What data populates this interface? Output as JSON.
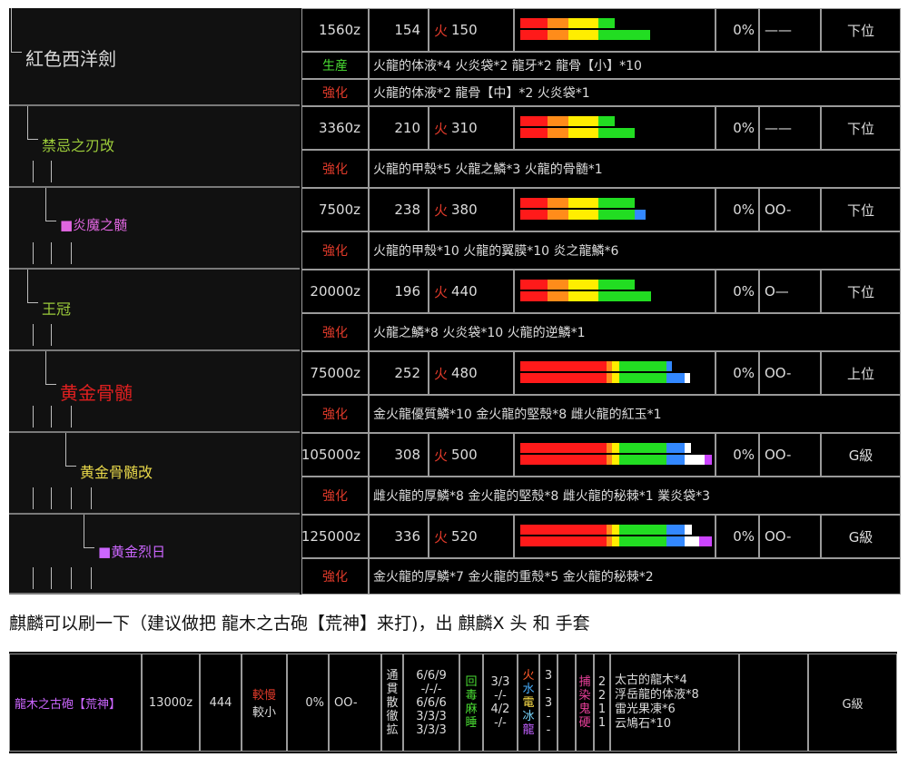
{
  "colors": {
    "fire": "#e03a2a",
    "gen": "#4ade33",
    "str": "#e03a2a",
    "white_name": "#d8d8d8",
    "green_name": "#9ccc3a",
    "pink_name": "#e066e0",
    "red_name": "#e02020",
    "yellow_name": "#e8d84a",
    "purple_name": "#cc66ff",
    "bar_red": "#ff1a1a",
    "bar_orange": "#ff8c1a",
    "bar_yellow": "#ffee00",
    "bar_green": "#22dd22",
    "bar_blue": "#3388ff",
    "bar_white": "#ffffff",
    "bar_purple": "#cc44ff"
  },
  "weapons": [
    {
      "name": "紅色西洋劍",
      "price": "1560z",
      "attack": "154",
      "element": "火",
      "element_value": "150",
      "affinity": "0%",
      "slots": "——",
      "rank": "下位",
      "recipes": [
        {
          "label": "生産",
          "text": "火龍的体液*4 火炎袋*2 龍牙*2 龍骨【小】*10"
        },
        {
          "label": "強化",
          "text": "火龍的体液*2 龍骨【中】*2 火炎袋*1"
        }
      ],
      "sharpness": [
        [
          30,
          23,
          33,
          18,
          0,
          0,
          0
        ],
        [
          30,
          23,
          33,
          57,
          0,
          0,
          0
        ]
      ]
    },
    {
      "name": "禁忌之刃改",
      "price": "3360z",
      "attack": "210",
      "element": "火",
      "element_value": "310",
      "affinity": "0%",
      "slots": "——",
      "rank": "下位",
      "recipes": [
        {
          "label": "強化",
          "text": "火龍的甲殼*5 火龍之鱗*3 火龍的骨髄*1"
        }
      ],
      "sharpness": [
        [
          30,
          23,
          33,
          18,
          0,
          0,
          0
        ],
        [
          30,
          23,
          33,
          40,
          0,
          0,
          0
        ]
      ]
    },
    {
      "name": "■炎魔之髄",
      "price": "7500z",
      "attack": "238",
      "element": "火",
      "element_value": "380",
      "affinity": "0%",
      "slots": "OO-",
      "rank": "下位",
      "recipes": [
        {
          "label": "強化",
          "text": "火龍的甲殼*10 火龍的翼膜*10 炎之龍鱗*6"
        }
      ],
      "sharpness": [
        [
          30,
          23,
          33,
          40,
          0,
          0,
          0
        ],
        [
          30,
          23,
          33,
          40,
          12,
          0,
          0
        ]
      ]
    },
    {
      "name": "王冠",
      "price": "20000z",
      "attack": "196",
      "element": "火",
      "element_value": "440",
      "affinity": "0%",
      "slots": "O—",
      "rank": "下位",
      "recipes": [
        {
          "label": "強化",
          "text": "火龍之鱗*8 火炎袋*10 火龍的逆鱗*1"
        }
      ],
      "sharpness": [
        [
          30,
          23,
          33,
          40,
          0,
          0,
          0
        ],
        [
          30,
          23,
          33,
          58,
          0,
          0,
          0
        ]
      ]
    },
    {
      "name": "黄金骨髄",
      "price": "75000z",
      "attack": "252",
      "element": "火",
      "element_value": "480",
      "affinity": "0%",
      "slots": "OO-",
      "rank": "上位",
      "recipes": [
        {
          "label": "強化",
          "text": "金火龍優質鱗*10 金火龍的堅殼*8 雌火龍的紅玉*1"
        }
      ],
      "sharpness": [
        [
          95,
          6,
          8,
          52,
          6,
          0,
          0
        ],
        [
          95,
          6,
          8,
          52,
          20,
          6,
          0
        ]
      ]
    },
    {
      "name": "黄金骨髄改",
      "price": "105000z",
      "attack": "308",
      "element": "火",
      "element_value": "500",
      "affinity": "0%",
      "slots": "OO-",
      "rank": "G級",
      "recipes": [
        {
          "label": "強化",
          "text": "雌火龍的厚鱗*8 金火龍的堅殼*8 雌火龍的秘棘*1 業炎袋*3"
        }
      ],
      "sharpness": [
        [
          95,
          6,
          8,
          52,
          20,
          7,
          0
        ],
        [
          95,
          6,
          8,
          52,
          20,
          22,
          8
        ]
      ]
    },
    {
      "name": "■黄金烈日",
      "price": "125000z",
      "attack": "336",
      "element": "火",
      "element_value": "520",
      "affinity": "0%",
      "slots": "OO-",
      "rank": "G級",
      "recipes": [
        {
          "label": "強化",
          "text": "金火龍的厚鱗*7 金火龍的重殼*5 金火龍的秘棘*2"
        }
      ],
      "sharpness": [
        [
          95,
          6,
          8,
          52,
          20,
          8,
          0
        ],
        [
          95,
          6,
          8,
          52,
          20,
          16,
          14
        ]
      ]
    }
  ],
  "caption": "麒麟可以刷一下（建议做把 龍木之古砲【荒神】来打)，出 麒麟X 头 和 手套",
  "gun": {
    "name": "龍木之古砲【荒神】",
    "price": "13000z",
    "attack": "444",
    "reload": "較慢",
    "recoil": "較小",
    "affinity": "0%",
    "slots": "OO-",
    "ammo_types": [
      "通",
      "貫",
      "散",
      "徹",
      "拡"
    ],
    "ammo_counts": [
      "6/6/9",
      "-/-/-",
      "6/6/6",
      "3/3/3",
      "3/3/3"
    ],
    "status_ammo": [
      "回",
      "毒",
      "麻",
      "睡"
    ],
    "status_counts": [
      "3/3",
      "-/-",
      "4/2",
      "-/-"
    ],
    "element_ammo": [
      "火",
      "水",
      "電",
      "冰",
      "龍"
    ],
    "element_counts": [
      "3",
      "-",
      "3",
      "-",
      "-"
    ],
    "special_ammo": [
      "捕",
      "染",
      "鬼",
      "硬"
    ],
    "special_counts": [
      "2",
      "2",
      "1",
      "1"
    ],
    "materials": [
      "太古的龍木*4",
      "浮岳龍的体液*8",
      "雷光果凍*6",
      "云鳩石*10"
    ],
    "rank": "G級"
  }
}
